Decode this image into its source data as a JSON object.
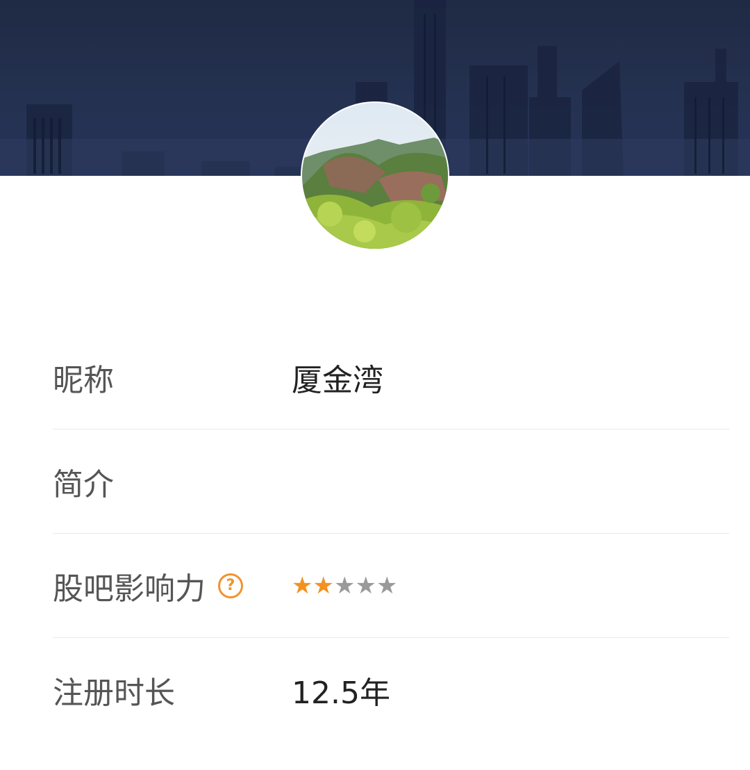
{
  "profile": {
    "avatar_icon": "landscape-photo-icon",
    "banner_icon": "city-skyline-icon"
  },
  "rows": {
    "nickname": {
      "label": "昵称",
      "value": "厦金湾"
    },
    "bio": {
      "label": "简介",
      "value": ""
    },
    "influence": {
      "label": "股吧影响力",
      "help_icon": "question-circle-icon",
      "help_glyph": "?",
      "rating": 2,
      "max_rating": 5,
      "star_glyph": "★"
    },
    "registration": {
      "label": "注册时长",
      "value": "12.5年"
    }
  },
  "colors": {
    "banner": "#243150",
    "accent": "#f39220",
    "star_off": "#9a9a9a",
    "label": "#555555",
    "value": "#222222",
    "divider": "#e8e8e8"
  }
}
